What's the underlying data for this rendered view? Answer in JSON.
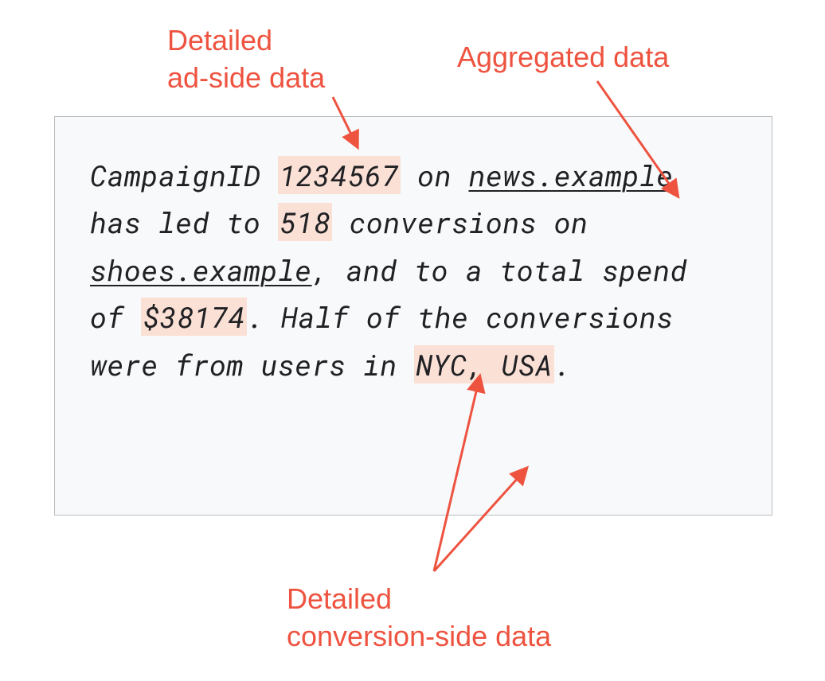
{
  "labels": {
    "topLeft_l1": "Detailed",
    "topLeft_l2": "ad-side data",
    "topRight": "Aggregated data",
    "bottom_l1": "Detailed",
    "bottom_l2": "conversion-side data"
  },
  "sentence": {
    "p1": "CampaignID ",
    "campaignId": "1234567",
    "p2": " on ",
    "site1": "news.example",
    "p3": " has led to ",
    "conversions": "518",
    "p4": " conversions on ",
    "site2": "shoes.example",
    "p5": ", and to a total spend of ",
    "spend": "$38174",
    "p6": ". Half of the conversions were from users in ",
    "location": "NYC, USA",
    "p7": "."
  },
  "colors": {
    "accent": "#ee5340",
    "highlight": "#fbe0d5",
    "boxBg": "#f7f9fa",
    "boxBorder": "#b9bdc0"
  }
}
